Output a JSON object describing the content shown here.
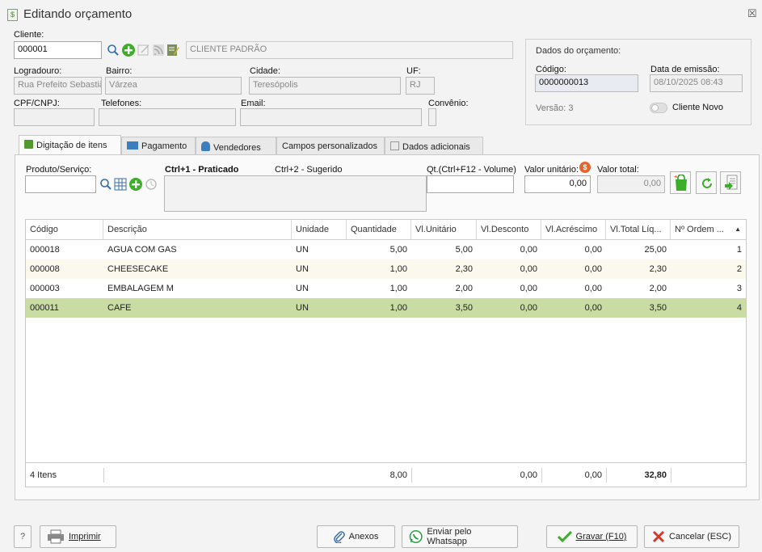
{
  "window": {
    "title": "Editando orçamento",
    "close_glyph": "☒"
  },
  "cliente": {
    "label": "Cliente:",
    "code": "000001",
    "name": "CLIENTE PADRÃO",
    "logradouro_label": "Logradouro:",
    "logradouro": "Rua Prefeito Sebastiã",
    "bairro_label": "Bairro:",
    "bairro": "Várzea",
    "cidade_label": "Cidade:",
    "cidade": "Teresópolis",
    "uf_label": "UF:",
    "uf": "RJ",
    "cpf_label": "CPF/CNPJ:",
    "cpf": "",
    "telefones_label": "Telefones:",
    "telefones": "",
    "email_label": "Email:",
    "email": "",
    "convenio_label": "Convênio:"
  },
  "orcamento": {
    "header": "Dados do orçamento:",
    "codigo_label": "Código:",
    "codigo": "0000000013",
    "data_label": "Data de emissão:",
    "data": "08/10/2025 08:43",
    "versao": "Versão: 3",
    "cliente_novo": "Cliente Novo"
  },
  "tabs": [
    {
      "label": "Digitação de itens"
    },
    {
      "label": "Pagamento"
    },
    {
      "label": "Vendedores"
    },
    {
      "label": "Campos personalizados"
    },
    {
      "label": "Dados adicionais"
    }
  ],
  "entry": {
    "produto_label": "Produto/Serviço:",
    "ctrl1": "Ctrl+1 - Praticado",
    "ctrl2": "Ctrl+2 - Sugerido",
    "qt_label": "Qt.(Ctrl+F12 - Volume)",
    "valor_unit_label": "Valor unitário:",
    "valor_unit": "0,00",
    "valor_total_label": "Valor total:",
    "valor_total": "0,00"
  },
  "grid": {
    "headers": [
      "Código",
      "Descrição",
      "Unidade",
      "Quantidade",
      "Vl.Unitário",
      "Vl.Desconto",
      "Vl.Acréscimo",
      "Vl.Total Líq...",
      "Nº Ordem ...",
      "▲"
    ],
    "rows": [
      [
        "000018",
        "AGUA COM GAS",
        "UN",
        "5,00",
        "5,00",
        "0,00",
        "0,00",
        "25,00",
        "1"
      ],
      [
        "000008",
        "CHEESECAKE",
        "UN",
        "1,00",
        "2,30",
        "0,00",
        "0,00",
        "2,30",
        "2"
      ],
      [
        "000003",
        "EMBALAGEM M",
        "UN",
        "1,00",
        "2,00",
        "0,00",
        "0,00",
        "2,00",
        "3"
      ],
      [
        "000011",
        "CAFE",
        "UN",
        "1,00",
        "3,50",
        "0,00",
        "0,00",
        "3,50",
        "4"
      ]
    ],
    "footer": {
      "count": "4 Itens",
      "quantidade": "8,00",
      "desconto": "0,00",
      "acrescimo": "0,00",
      "total": "32,80"
    }
  },
  "buttons": {
    "help": "?",
    "imprimir": "Imprimir",
    "anexos": "Anexos",
    "whatsapp": "Enviar pelo Whatsapp",
    "gravar": "Gravar (F10)",
    "cancelar": "Cancelar (ESC)"
  },
  "colors": {
    "selected_row": "#c8dca4",
    "alt_row": "#fbf9ee",
    "green": "#3cae2a",
    "orange": "#e2662d"
  }
}
